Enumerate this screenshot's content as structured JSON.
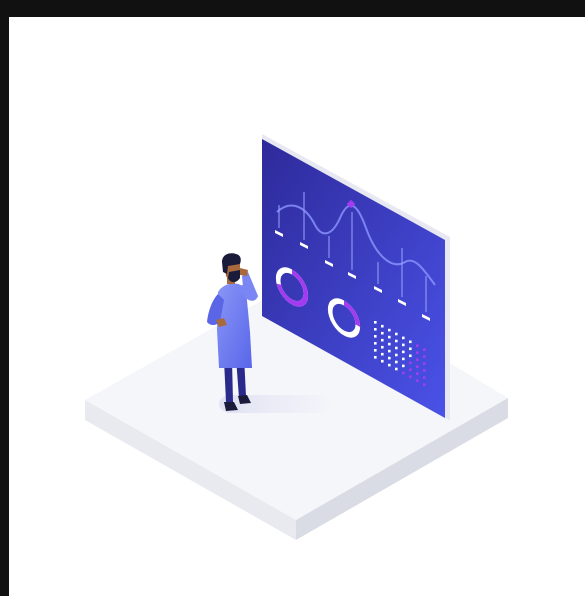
{
  "illustration": {
    "scene": "analyst-reviewing-dashboard",
    "icons": {
      "platform": "isometric-platform-icon",
      "person": "analyst-figure-icon",
      "screen": "dashboard-screen-icon",
      "line_chart": "line-chart-icon",
      "donut_chart": "donut-chart-icon",
      "dot_grid": "dot-matrix-icon"
    },
    "colors": {
      "page_background": "#111111",
      "canvas_background": "#ffffff",
      "platform_top": "#f5f6fa",
      "platform_side_left": "#e8eaf0",
      "platform_side_right": "#d9dce5",
      "screen_dark": "#2e2a9a",
      "screen_light": "#4a52e8",
      "screen_edge": "#e7e8f2",
      "accent_purple": "#a33cf0",
      "accent_white": "#ffffff",
      "coat": "#6f7bf2",
      "trousers": "#2a2a8c",
      "skin": "#a86a3c",
      "hair": "#1a1a3a",
      "shadow": "#e1e3f3"
    },
    "donut_charts": [
      {
        "purple_fraction": 0.7
      },
      {
        "purple_fraction": 0.25
      }
    ],
    "dot_grid": {
      "rows": 6,
      "columns": 8
    }
  }
}
